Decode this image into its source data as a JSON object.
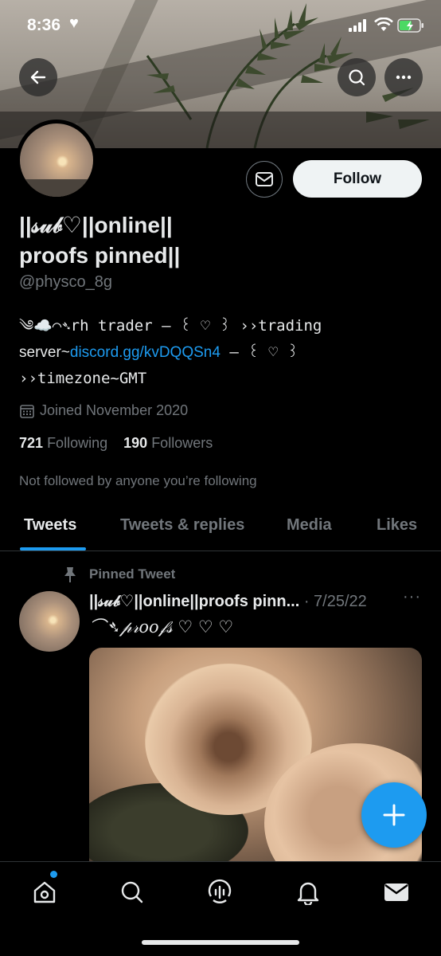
{
  "status_bar": {
    "time": "8:36",
    "heart": "♥"
  },
  "profile": {
    "name_line1": "||𝓈𝓊𝒷♡||online||",
    "name_line2": "proofs pinned||",
    "handle": "@physco_8g",
    "bio_line1": "༄☁️⌒➴rh trader — ꒰ ♡ ꒱ ››trading",
    "bio_line2_prefix": "server~",
    "bio_link": "discord.gg/kvDQQSn4",
    "bio_line2_suffix": " — ꒰ ♡ ꒱",
    "bio_line3": "››timezone~GMT",
    "joined": "Joined November 2020",
    "following_count": "721",
    "following_label": "Following",
    "followers_count": "190",
    "followers_label": "Followers",
    "not_followed": "Not followed by anyone you’re following",
    "follow_button": "Follow"
  },
  "tabs": [
    {
      "label": "Tweets",
      "active": true
    },
    {
      "label": "Tweets & replies",
      "active": false
    },
    {
      "label": "Media",
      "active": false
    },
    {
      "label": "Likes",
      "active": false
    }
  ],
  "pinned_tweet": {
    "pinned_label": "Pinned Tweet",
    "author_name": "||𝓈𝓊𝒷♡||online||proofs pinn...",
    "date": "· 7/25/22",
    "more": "···",
    "text": "⌒➴𝓅𝓇𝑜𝑜𝒻𝓈  ♡  ♡  ♡"
  },
  "icons": {
    "back": "back-arrow-icon",
    "search": "search-icon",
    "more": "more-icon",
    "mail": "mail-icon",
    "calendar": "calendar-icon",
    "pin": "pin-icon",
    "compose": "plus-icon",
    "nav": [
      "home-icon",
      "search-icon",
      "spaces-icon",
      "notifications-icon",
      "messages-icon"
    ]
  },
  "colors": {
    "accent": "#1d9bf0",
    "background": "#000000",
    "text_primary": "#e7e9ea",
    "text_secondary": "#71767b"
  }
}
